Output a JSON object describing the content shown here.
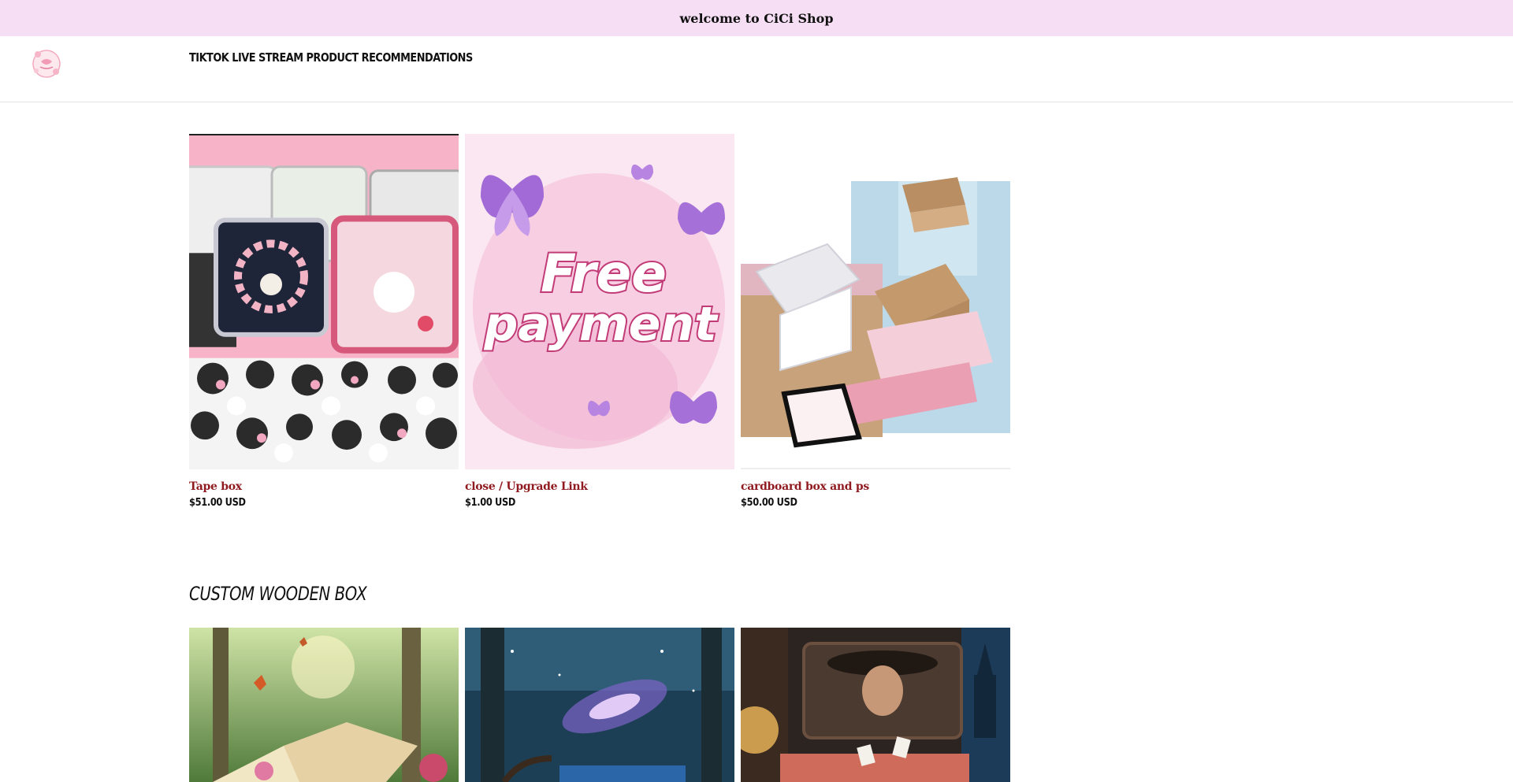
{
  "announcement": {
    "text": "welcome to CiCi Shop"
  },
  "header": {
    "logo_icon": "cici-shop-logo-icon",
    "nav_link": "TIKTOK LIVE STREAM PRODUCT RECOMMENDATIONS"
  },
  "products": [
    {
      "title": "Tape box",
      "price": "$51.00 USD",
      "image": "tin-boxes-and-stickers"
    },
    {
      "title": "close / Upgrade Link",
      "price": "$1.00 USD",
      "image": "free-payment-butterflies"
    },
    {
      "title": "cardboard box and ps",
      "price": "$50.00 USD",
      "image": "mailer-boxes"
    }
  ],
  "section": {
    "heading": "CUSTOM WOODEN BOX",
    "images": [
      "forest-butterfly-box",
      "galaxy-forest-box",
      "victorian-portrait-box"
    ]
  },
  "colors": {
    "announcement_bg": "#f6dff4",
    "title_color": "#8f1a1f",
    "divider": "#e4e4e4"
  }
}
